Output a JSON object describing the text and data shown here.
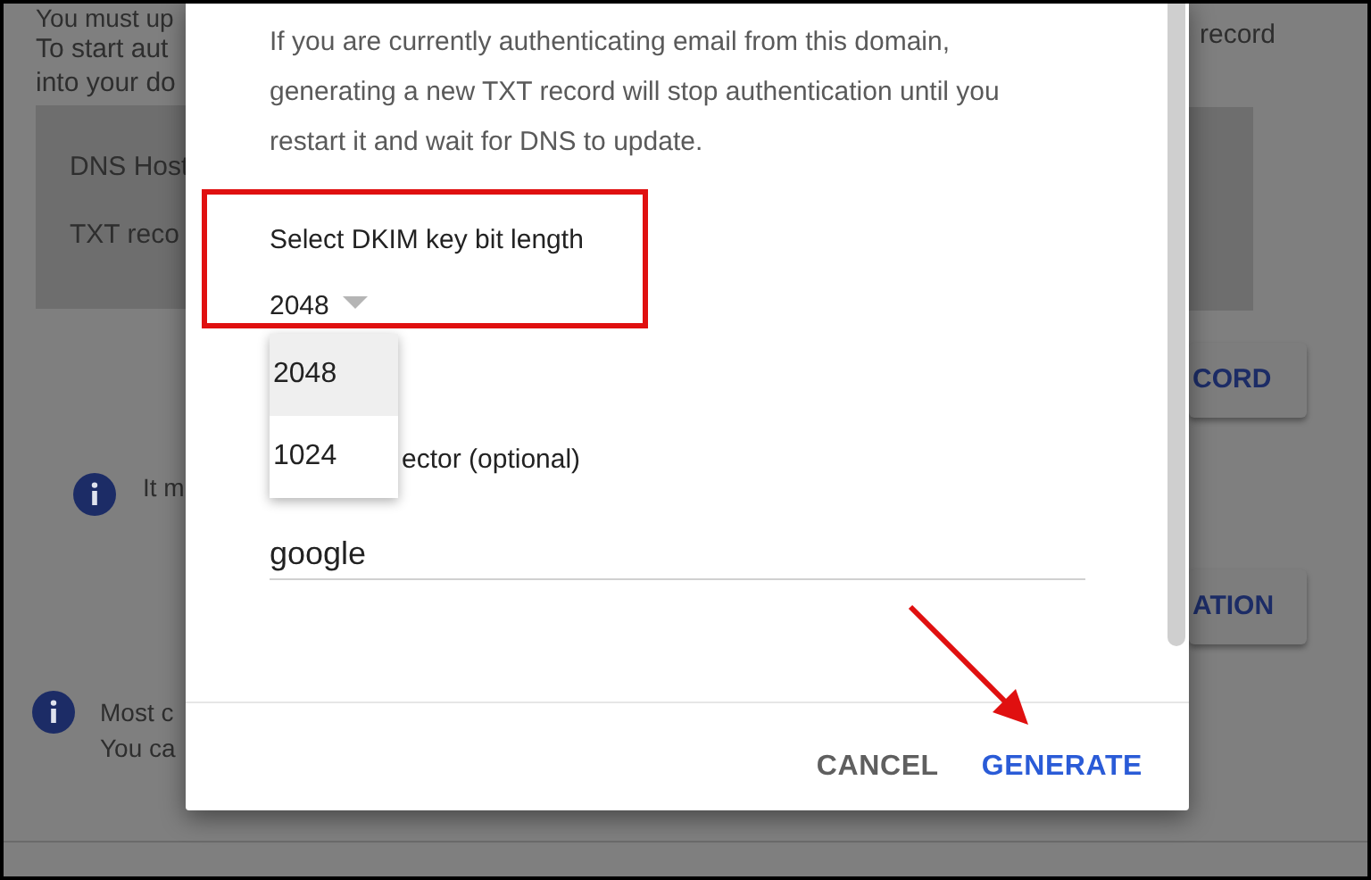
{
  "background": {
    "heading_fragment": "You must up",
    "intro_left": [
      "To start aut",
      "into your do"
    ],
    "intro_right": "record",
    "dns_rows": [
      "DNS Host",
      "TXT reco"
    ],
    "buttons": [
      "CORD",
      "ATION"
    ],
    "notes": [
      {
        "lines": [
          "It m"
        ]
      },
      {
        "lines": [
          "Most c",
          "You ca"
        ]
      }
    ]
  },
  "dialog": {
    "warning": "If you are currently authenticating email from this domain, generating a new TXT record will stop authentication until you restart it and wait for DNS to update.",
    "key_length": {
      "label": "Select DKIM key bit length",
      "value": "2048",
      "options": [
        {
          "label": "2048",
          "selected": true
        },
        {
          "label": "1024",
          "selected": false
        }
      ]
    },
    "selector": {
      "label_fragment": "ector (optional)",
      "value": "google"
    },
    "buttons": [
      {
        "label": "CANCEL",
        "kind": "secondary"
      },
      {
        "label": "GENERATE",
        "kind": "primary"
      }
    ]
  }
}
